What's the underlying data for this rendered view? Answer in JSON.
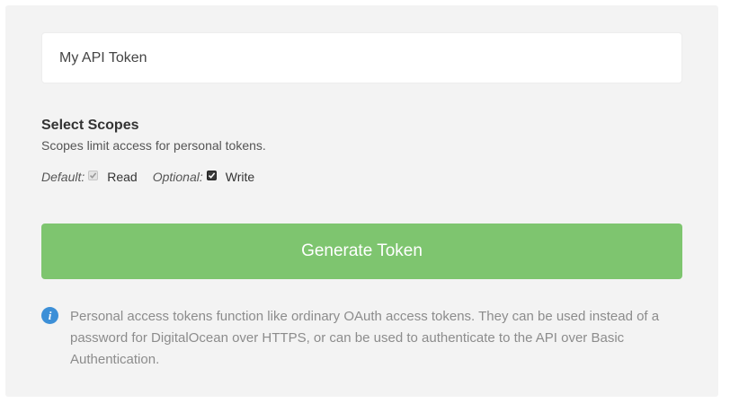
{
  "token_form": {
    "name_value": "My API Token",
    "scopes": {
      "title": "Select Scopes",
      "subtitle": "Scopes limit access for personal tokens.",
      "default_prefix": "Default:",
      "read_label": "Read",
      "read_checked": true,
      "read_disabled": true,
      "optional_prefix": "Optional:",
      "write_label": "Write",
      "write_checked": true
    },
    "generate_label": "Generate Token",
    "info_text": "Personal access tokens function like ordinary OAuth access tokens. They can be used instead of a password for DigitalOcean over HTTPS, or can be used to authenticate to the API over Basic Authentication."
  },
  "colors": {
    "panel_bg": "#f3f3f3",
    "button_green": "#7ec56f",
    "info_blue": "#3c8fd7",
    "info_text": "#8c8c8c"
  },
  "icons": {
    "info": "info-icon",
    "check": "checkmark-icon"
  }
}
